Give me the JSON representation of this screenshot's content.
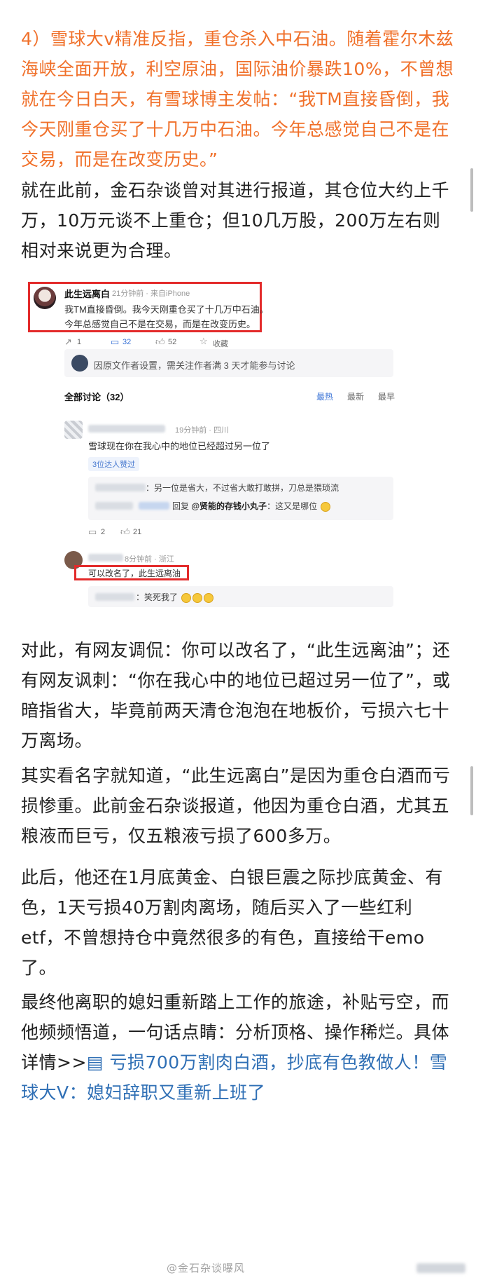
{
  "article": {
    "p1": "4）雪球大v精准反指，重仓杀入中石油。随着霍尔木兹海峡全面开放，利空原油，国际油价暴跌10%，不曾想就在今日白天，有雪球博主发帖：“我TM直接昏倒，我今天刚重仓买了十几万中石油。今年总感觉自己不是在交易，而是在改变历史。”",
    "p2": "就在此前，金石杂谈曾对其进行报道，其仓位大约上千万，10万元谈不上重仓；但10几万股，200万左右则相对来说更为合理。",
    "p3": "对此，有网友调侃：你可以改名了，“此生远离油”；还有网友讽刺：“你在我心中的地位已超过另一位了”，或暗指省大，毕竟前两天清仓泡泡在地板价，亏损六七十万离场。",
    "p4": "其实看名字就知道，“此生远离白”是因为重仓白酒而亏损惨重。此前金石杂谈报道，他因为重仓白酒，尤其五粮液而巨亏，仅五粮液亏损了600多万。",
    "p5": "此后，他还在1月底黄金、白银巨震之际抄底黄金、有色，1天亏损40万割肉离场，随后买入了一些红利etf，不曾想持仓中竟然很多的有色，直接给干emo了。",
    "p6_text": "最终他离职的媳妇重新踏上工作的旅途，补贴亏空，而他频频悟道，一句话点睛：分析顶格、操作稀烂。具体详情>>",
    "p6_link": "亏损700万割肉白酒，抄底有色教做人！雪球大V：媳妇辞职又重新上班了"
  },
  "post": {
    "author": "此生远离白",
    "meta": "21分钟前 · 来自iPhone",
    "line1": "我TM直接昏倒。我今天刚重仓买了十几万中石油。",
    "line2": "今年总感觉自己不是在交易，而是在改变历史。",
    "reposts": "1",
    "comments": "32",
    "likes": "52",
    "fav": "收藏",
    "notice": "因原文作者设置，需关注作者满 3 天才能参与讨论"
  },
  "discussion": {
    "title": "全部讨论（32）",
    "tabs": [
      "最热",
      "最新",
      "最早"
    ],
    "c1_meta": "19分钟前 · 四川",
    "c1_text": "雪球现在你在我心中的地位已经超过另一位了",
    "c1_badge": "3位达人赞过",
    "r1_text": "：另一位是省大，不过省大敢打敢拼，刀总是猥琐流",
    "r2_prefix": "回复",
    "r2_mention": "@贤能的存钱小丸子",
    "r2_text": "：这又是哪位",
    "c1_comments": "2",
    "c1_likes": "21",
    "c2_meta": "8分钟前 · 浙江",
    "c2_text": "可以改名了，此生远离油",
    "r3_text": "：笑死我了"
  },
  "watermark": "@金石杂谈曝风"
}
